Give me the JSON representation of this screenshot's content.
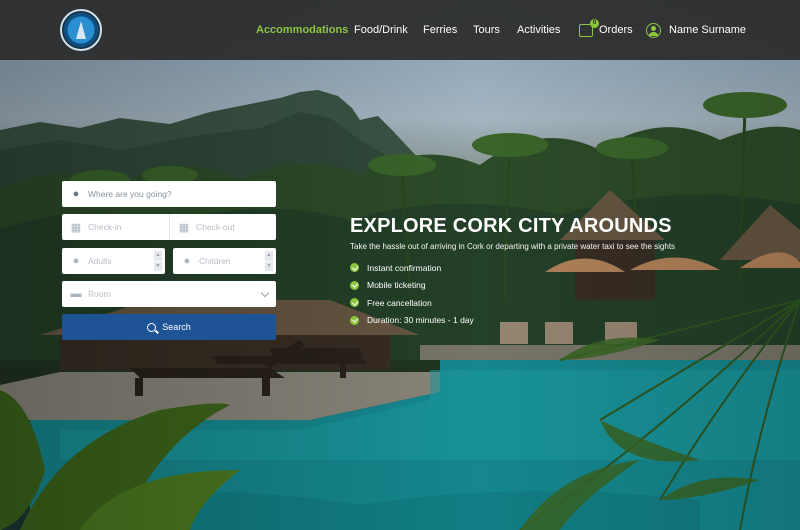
{
  "header": {
    "logo_alt": "THE SECRET SOUTH",
    "nav": [
      {
        "label": "Accommodations",
        "active": true
      },
      {
        "label": "Food/Drink"
      },
      {
        "label": "Ferries"
      },
      {
        "label": "Tours"
      },
      {
        "label": "Activities"
      }
    ],
    "orders": {
      "label": "Orders",
      "badge": "0",
      "icon": "cart-icon"
    },
    "user": {
      "name": "Name Surname",
      "icon": "user-icon"
    },
    "accent_color": "#8dc63f"
  },
  "search": {
    "destination": {
      "placeholder": "Where are you going?",
      "icon": "map-pin-icon"
    },
    "checkin": {
      "placeholder": "Check-in",
      "icon": "calendar-icon"
    },
    "checkout": {
      "placeholder": "Check-out",
      "icon": "calendar-icon"
    },
    "adults": {
      "placeholder": "Adults",
      "icon": "person-icon"
    },
    "children": {
      "placeholder": "Children",
      "icon": "person-icon"
    },
    "room": {
      "placeholder": "Room",
      "icon": "bed-icon"
    },
    "button_label": "Search",
    "button_color": "#1e5396"
  },
  "hero": {
    "title": "EXPLORE CORK CITY AROUNDS",
    "subtitle": "Take the hassle out of arriving in Cork or departing with a private water taxi to see the sights",
    "features": [
      "Instant confirmation",
      "Mobile ticketing",
      "Free cancellation",
      "Duration: 30 minutes - 1 day"
    ]
  }
}
